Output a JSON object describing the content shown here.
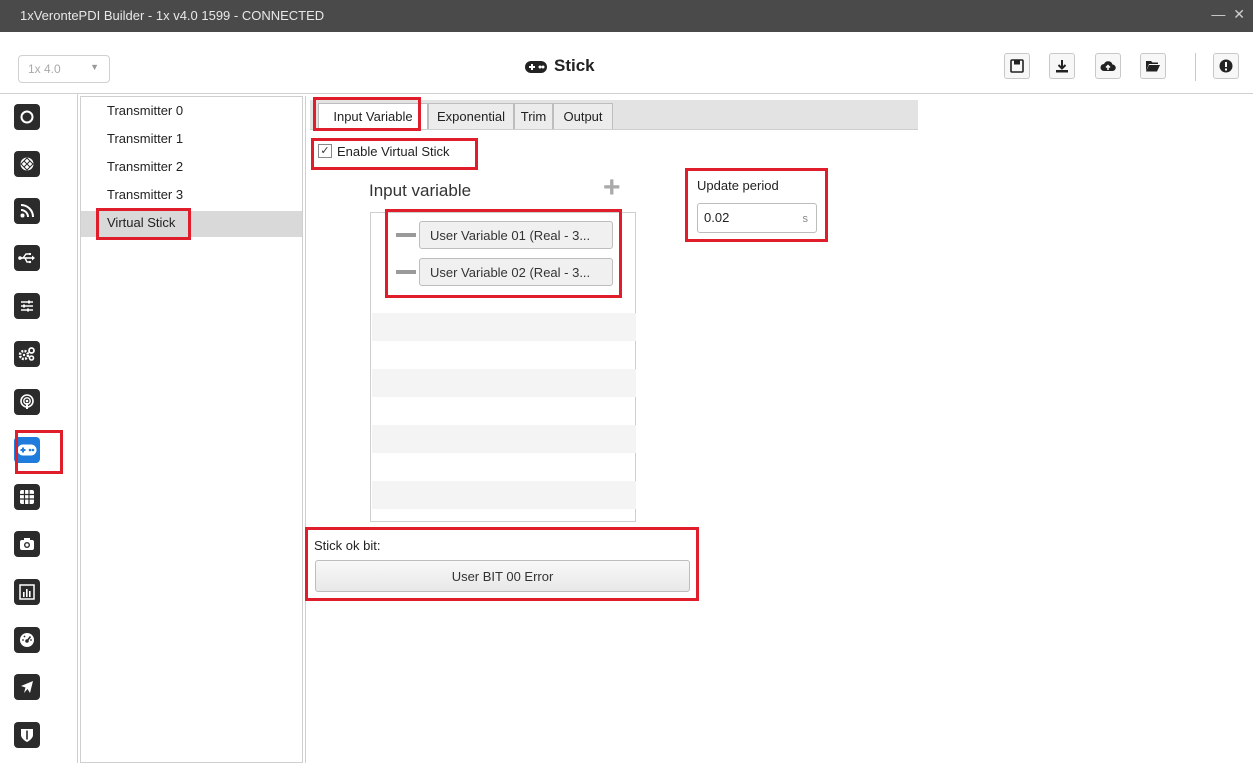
{
  "window": {
    "title": "1xVerontePDI Builder - 1x v4.0 1599 - CONNECTED",
    "minimize": "—",
    "close": "✕"
  },
  "toolbar": {
    "version_select": "1x 4.0",
    "page_title": "Stick",
    "icons": [
      "save-icon",
      "download-icon",
      "cloud-upload-icon",
      "open-folder-icon",
      "info-icon"
    ]
  },
  "sidebar": {
    "icons": [
      "power-icon",
      "sphere-icon",
      "rss-icon",
      "usb-icon",
      "sliders-icon",
      "cogs-icon",
      "podcast-icon",
      "gamepad-icon",
      "grid-icon",
      "camera-icon",
      "chart-icon",
      "gauge-icon",
      "plane-icon",
      "shield-icon"
    ],
    "active": "gamepad-icon"
  },
  "transmitters": {
    "items": [
      "Transmitter 0",
      "Transmitter 1",
      "Transmitter 2",
      "Transmitter 3",
      "Virtual Stick"
    ],
    "selected": "Virtual Stick"
  },
  "tabs": {
    "items": [
      "Input Variable",
      "Exponential",
      "Trim",
      "Output"
    ],
    "active": "Input Variable"
  },
  "config": {
    "enable_label": "Enable Virtual Stick",
    "enable_checked": true,
    "enable_check_glyph": "✓",
    "input_variable_heading": "Input variable",
    "add_glyph": "+",
    "variables": [
      "User Variable 01 (Real - 3...",
      "User Variable 02 (Real - 3..."
    ],
    "update_period_label": "Update period",
    "update_period_value": "0.02",
    "update_period_unit": "s",
    "stick_ok_label": "Stick ok bit:",
    "stick_ok_value": "User BIT 00 Error"
  },
  "colors": {
    "highlight": "#e01e2b",
    "active_icon": "#1f7bdc",
    "titlebar": "#4a4a4a"
  }
}
